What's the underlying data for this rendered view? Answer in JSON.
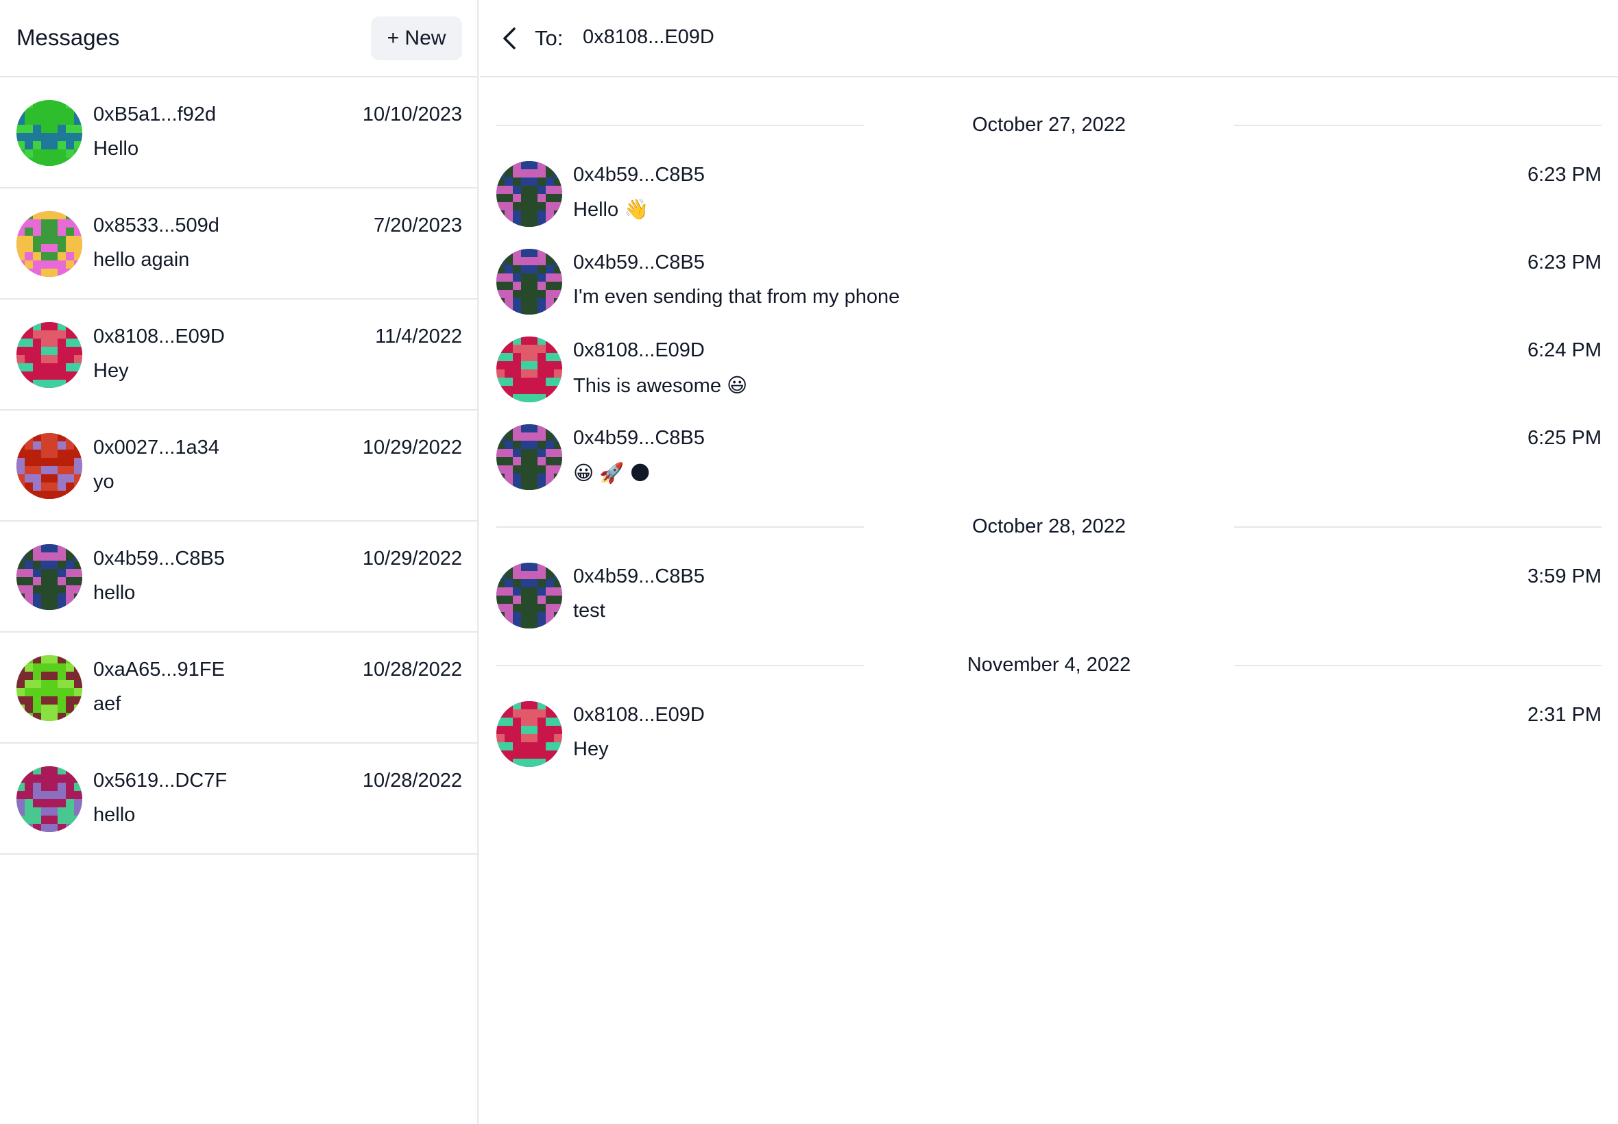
{
  "sidebar": {
    "title": "Messages",
    "new_button_label": "+ New",
    "conversations": [
      {
        "name": "0xB5a1...f92d",
        "date": "10/10/2023",
        "preview": "Hello",
        "avatar": "avatar-green-blue"
      },
      {
        "name": "0x8533...509d",
        "date": "7/20/2023",
        "preview": "hello again",
        "avatar": "avatar-pink-yellow"
      },
      {
        "name": "0x8108...E09D",
        "date": "11/4/2022",
        "preview": "Hey",
        "avatar": "avatar-crimson-teal"
      },
      {
        "name": "0x0027...1a34",
        "date": "10/29/2022",
        "preview": "yo",
        "avatar": "avatar-red-purple"
      },
      {
        "name": "0x4b59...C8B5",
        "date": "10/29/2022",
        "preview": "hello",
        "avatar": "avatar-navy-magenta"
      },
      {
        "name": "0xaA65...91FE",
        "date": "10/28/2022",
        "preview": "aef",
        "avatar": "avatar-lime-maroon"
      },
      {
        "name": "0x5619...DC7F",
        "date": "10/28/2022",
        "preview": "hello",
        "avatar": "avatar-teal-magenta"
      }
    ]
  },
  "chat": {
    "to_label": "To:",
    "to_value": "0x8108...E09D",
    "date_separators": [
      "October 27, 2022",
      "October 28, 2022",
      "November 4, 2022"
    ],
    "messages": [
      {
        "sender": "0x4b59...C8B5",
        "time": "6:23 PM",
        "text": "Hello 👋",
        "avatar": "avatar-navy-magenta"
      },
      {
        "sender": "0x4b59...C8B5",
        "time": "6:23 PM",
        "text": "I'm even sending that from my phone",
        "avatar": "avatar-navy-magenta"
      },
      {
        "sender": "0x8108...E09D",
        "time": "6:24 PM",
        "text": "This is awesome 😃",
        "avatar": "avatar-crimson-teal"
      },
      {
        "sender": "0x4b59...C8B5",
        "time": "6:25 PM",
        "text": "😀 🚀 🌑",
        "avatar": "avatar-navy-magenta"
      },
      {
        "sender": "0x4b59...C8B5",
        "time": "3:59 PM",
        "text": "test",
        "avatar": "avatar-navy-magenta"
      },
      {
        "sender": "0x8108...E09D",
        "time": "2:31 PM",
        "text": "Hey",
        "avatar": "avatar-crimson-teal"
      }
    ]
  },
  "colors": {
    "border": "#e5e7eb",
    "new_button_bg": "#f0f2f5",
    "text": "#111827"
  },
  "avatar_palettes": {
    "avatar-green-blue": [
      "#3fd13f",
      "#1f7a9a",
      "#2dbd2d"
    ],
    "avatar-pink-yellow": [
      "#e86ad8",
      "#f5c048",
      "#3c9a3c"
    ],
    "avatar-crimson-teal": [
      "#c8164a",
      "#3fd0a0",
      "#e05a6a"
    ],
    "avatar-red-purple": [
      "#b8200c",
      "#d0402a",
      "#9a78c8"
    ],
    "avatar-navy-magenta": [
      "#27408e",
      "#274a2a",
      "#c860b8"
    ],
    "avatar-lime-maroon": [
      "#5bd01c",
      "#7a2a30",
      "#8ae040"
    ],
    "avatar-teal-magenta": [
      "#48c890",
      "#a81a5a",
      "#8a70c0"
    ]
  }
}
